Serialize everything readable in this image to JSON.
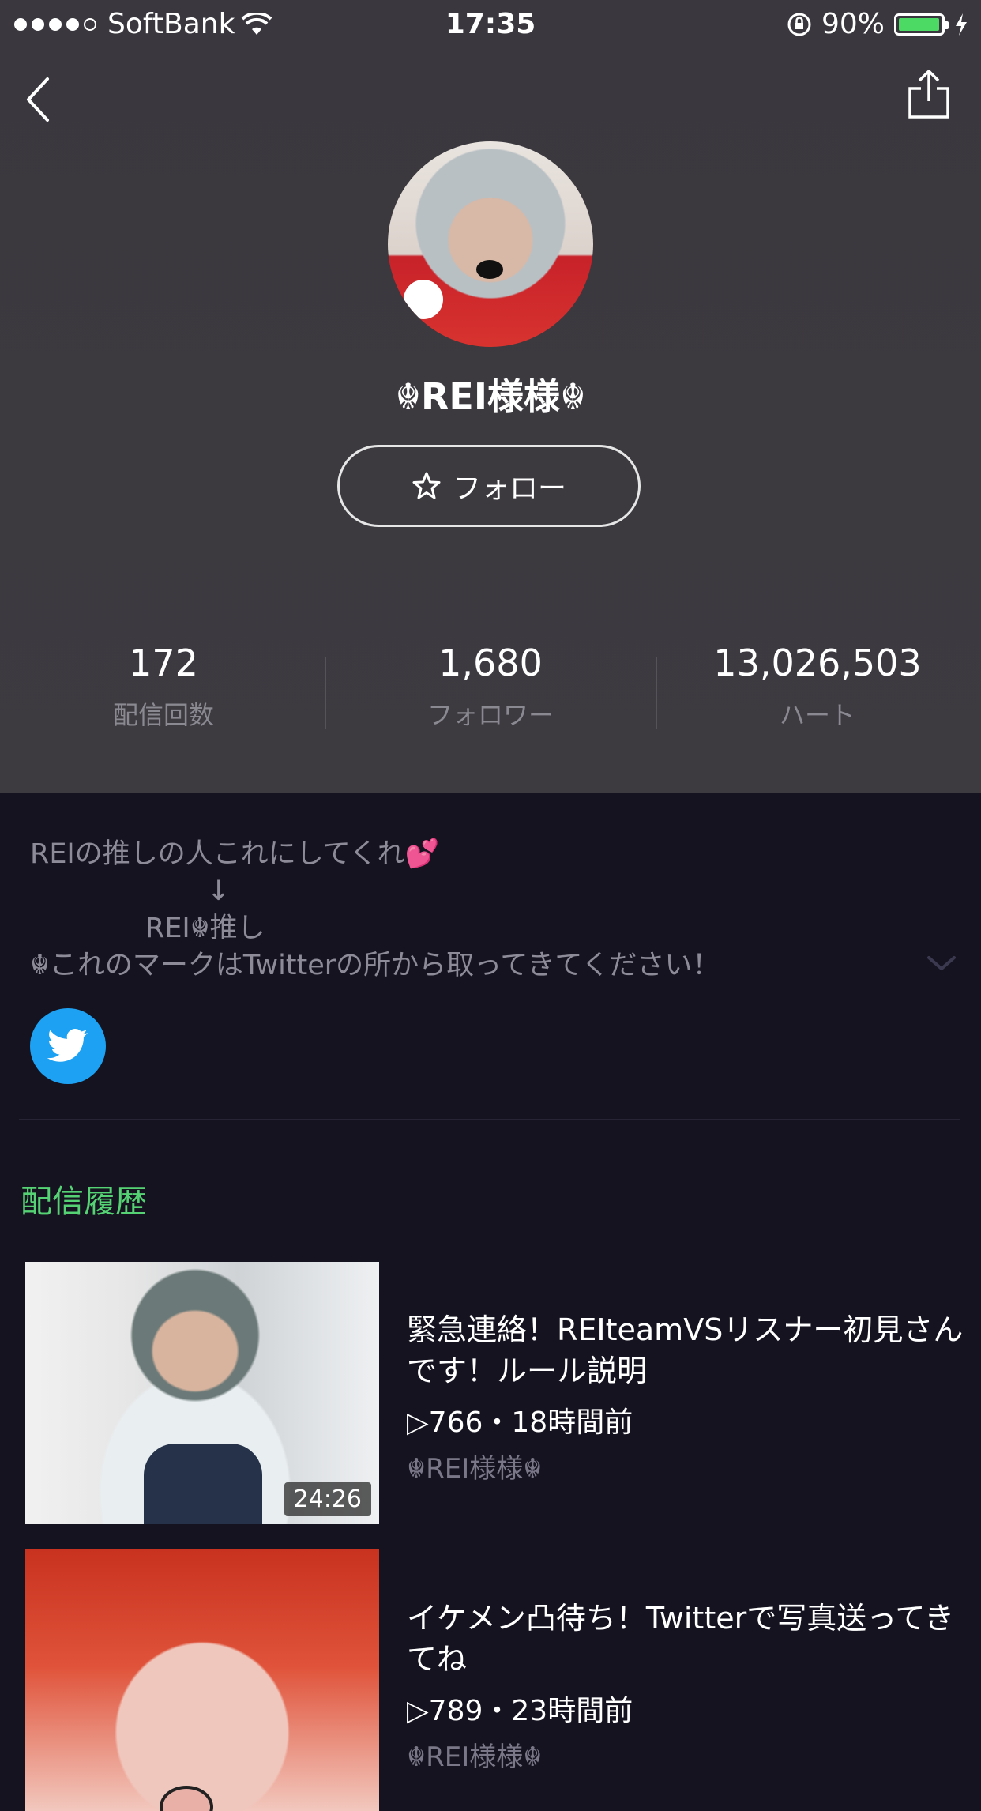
{
  "status_bar": {
    "carrier": "SoftBank",
    "time": "17:35",
    "battery": "90%"
  },
  "profile": {
    "name": "☬REI様様☬",
    "follow_label": "フォロー",
    "stats": [
      {
        "value": "172",
        "label": "配信回数"
      },
      {
        "value": "1,680",
        "label": "フォロワー"
      },
      {
        "value": "13,026,503",
        "label": "ハート"
      }
    ],
    "bio_lines": [
      "REIの推しの人これにしてくれ💕",
      "                ↓",
      "           REI☬推し",
      "☬これのマークはTwitterの所から取ってきてください！"
    ]
  },
  "history": {
    "title": "配信履歴",
    "items": [
      {
        "title": "緊急連絡！REIteamVSリスナー初見さんです！ルール説明",
        "views": "▷766・18時間前",
        "author": "☬REI様様☬",
        "duration": "24:26"
      },
      {
        "title": "イケメン凸待ち！Twitterで写真送ってきてね",
        "views": "▷789・23時間前",
        "author": "☬REI様様☬",
        "duration": ""
      }
    ]
  },
  "colors": {
    "accent": "#55d374",
    "twitter": "#1da1f2"
  }
}
